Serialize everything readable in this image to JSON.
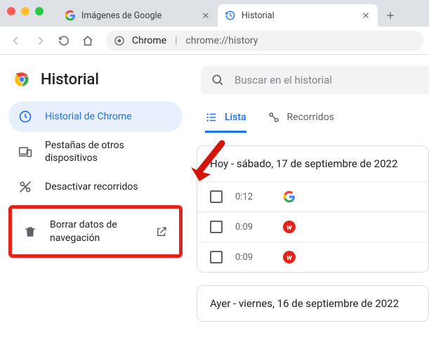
{
  "window": {
    "tabs": [
      {
        "title": "Imágenes de Google",
        "active": false
      },
      {
        "title": "Historial",
        "active": true
      }
    ]
  },
  "omnibox": {
    "prefix": "Chrome",
    "url": "chrome://history"
  },
  "sidebar": {
    "title": "Historial",
    "items": {
      "chrome_history": "Historial de Chrome",
      "other_devices": "Pestañas de otros dispositivos",
      "disable_journeys": "Desactivar recorridos",
      "clear_data": "Borrar datos de navegación"
    }
  },
  "search": {
    "placeholder": "Buscar en el historial"
  },
  "view_tabs": {
    "list": "Lista",
    "journeys": "Recorridos"
  },
  "history": {
    "today_label": "Hoy - sábado, 17 de septiembre de 2022",
    "yesterday_label": "Ayer - viernes, 16 de septiembre de 2022",
    "entries": [
      {
        "time": "0:12",
        "site": "google"
      },
      {
        "time": "0:09",
        "site": "w"
      },
      {
        "time": "0:09",
        "site": "w"
      }
    ]
  }
}
